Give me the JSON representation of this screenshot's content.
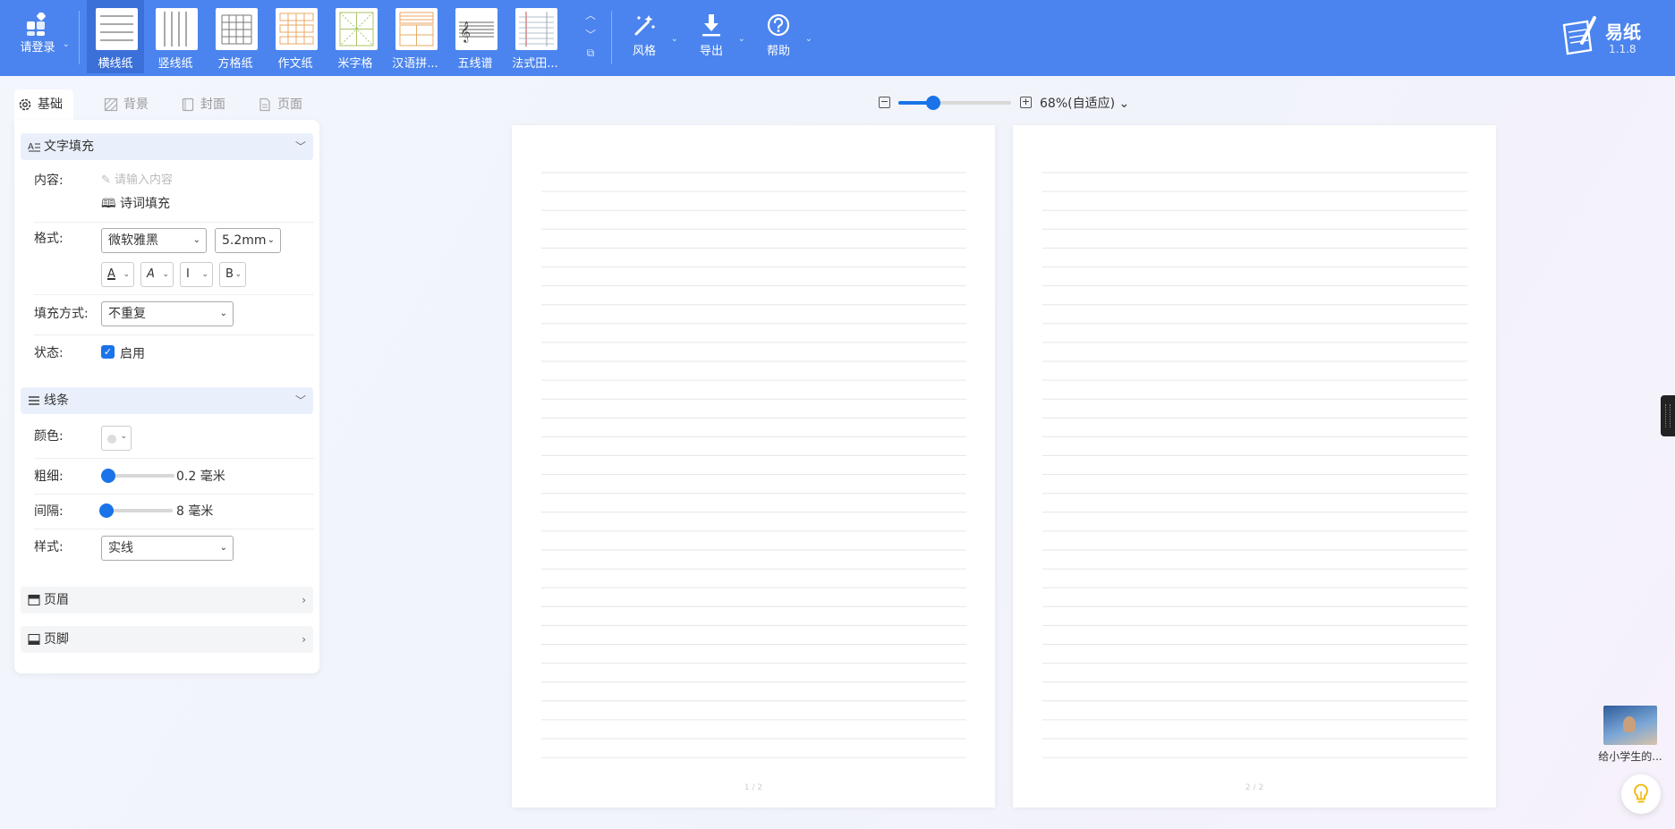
{
  "header": {
    "login_label": "请登录",
    "paper_types": [
      {
        "label": "横线纸",
        "icon": "horizontal-lines-icon",
        "active": true
      },
      {
        "label": "竖线纸",
        "icon": "vertical-lines-icon"
      },
      {
        "label": "方格纸",
        "icon": "grid-icon"
      },
      {
        "label": "作文纸",
        "icon": "composition-grid-icon"
      },
      {
        "label": "米字格",
        "icon": "mi-grid-icon"
      },
      {
        "label": "汉语拼...",
        "icon": "pinyin-grid-icon"
      },
      {
        "label": "五线谱",
        "icon": "staff-icon"
      },
      {
        "label": "法式田...",
        "icon": "french-grid-icon"
      }
    ],
    "tools": [
      {
        "label": "风格",
        "icon": "magic-wand-icon"
      },
      {
        "label": "导出",
        "icon": "download-icon"
      },
      {
        "label": "帮助",
        "icon": "help-icon"
      }
    ],
    "brand": {
      "name": "易纸",
      "version": "1.1.8"
    }
  },
  "left_panel": {
    "tabs": [
      "基础",
      "背景",
      "封面",
      "页面"
    ],
    "text_fill": {
      "title": "文字填充",
      "content_label": "内容:",
      "content_placeholder": "请输入内容",
      "poem_fill": "诗词填充",
      "format_label": "格式:",
      "font": "微软雅黑",
      "font_size": "5.2mm",
      "format_buttons": [
        "A",
        "A",
        "I",
        "B"
      ],
      "fill_mode_label": "填充方式:",
      "fill_mode": "不重复",
      "status_label": "状态:",
      "status_text": "启用",
      "status_enabled": true
    },
    "lines": {
      "title": "线条",
      "color_label": "颜色:",
      "width_label": "粗细:",
      "width_value": "0.2",
      "width_unit": "毫米",
      "spacing_label": "间隔:",
      "spacing_value": "8",
      "spacing_unit": "毫米",
      "style_label": "样式:",
      "style": "实线"
    },
    "header_section": "页眉",
    "footer_section": "页脚"
  },
  "zoom": {
    "minus": "−",
    "plus": "+",
    "label": "68%(自适应)",
    "level": 0.68
  },
  "pages": [
    {
      "number": "1 / 2"
    },
    {
      "number": "2 / 2"
    }
  ],
  "side": {
    "video_title": "给小学生的..."
  },
  "colors": {
    "toolbar": "#4b84ee",
    "accent": "#1a73e8",
    "line": "#e6e6e6"
  }
}
